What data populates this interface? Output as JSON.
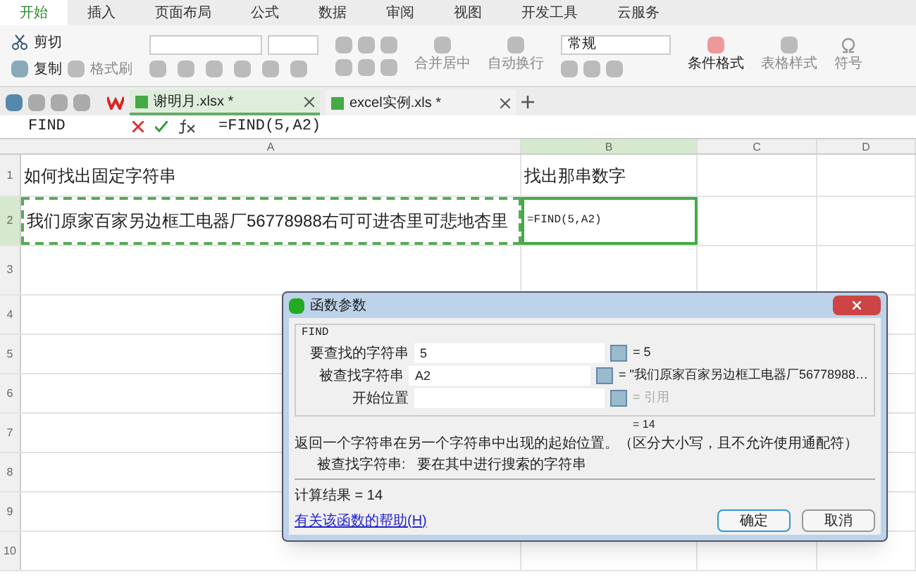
{
  "menu_tabs": [
    {
      "label": "开始",
      "selected": true
    },
    {
      "label": "插入",
      "selected": false
    },
    {
      "label": "页面布局",
      "selected": false
    },
    {
      "label": "公式",
      "selected": false
    },
    {
      "label": "数据",
      "selected": false
    },
    {
      "label": "审阅",
      "selected": false
    },
    {
      "label": "视图",
      "selected": false
    },
    {
      "label": "开发工具",
      "selected": false
    },
    {
      "label": "云服务",
      "selected": false
    }
  ],
  "ribbon": {
    "cut": "剪切",
    "copy": "复制",
    "format_painter": "格式刷",
    "merge": "合并居中",
    "wrap": "自动换行",
    "number_format": "常规",
    "conditional": "条件格式",
    "table_style": "表格样式",
    "symbol": "符号"
  },
  "doc_tabs": [
    {
      "label": "谢明月.xlsx *",
      "selected": true
    },
    {
      "label": "excel实例.xls *",
      "selected": false
    }
  ],
  "formula_bar": {
    "name_box": "FIND",
    "formula": "=FIND(5,A2)"
  },
  "columns": [
    {
      "label": "A",
      "selected": false
    },
    {
      "label": "B",
      "selected": true
    },
    {
      "label": "C",
      "selected": false
    },
    {
      "label": "D",
      "selected": false
    }
  ],
  "rows": [
    {
      "label": "1",
      "selected": false,
      "cells": [
        "如何找出固定字符串",
        "找出那串数字"
      ]
    },
    {
      "label": "2",
      "selected": true,
      "cells": [
        "我们原家百家另边框工电器厂56778988右可可进杏里可悲地杏里",
        "=FIND(5,A2)"
      ]
    },
    {
      "label": "3",
      "selected": false,
      "cells": []
    },
    {
      "label": "4",
      "selected": false,
      "cells": []
    },
    {
      "label": "5",
      "selected": false,
      "cells": []
    },
    {
      "label": "6",
      "selected": false,
      "cells": []
    },
    {
      "label": "7",
      "selected": false,
      "cells": []
    },
    {
      "label": "8",
      "selected": false,
      "cells": []
    },
    {
      "label": "9",
      "selected": false,
      "cells": []
    },
    {
      "label": "10",
      "selected": false,
      "cells": []
    }
  ],
  "dialog": {
    "title": "函数参数",
    "function": "FIND",
    "args": [
      {
        "label": "要查找的字符串",
        "value": "5",
        "result": "= 5",
        "disabled": false
      },
      {
        "label": "被查找字符串",
        "value": "A2",
        "result": "= \"我们原家百家另边框工电器厂56778988…",
        "disabled": false
      },
      {
        "label": "开始位置",
        "result": "= 引用",
        "disabled": true
      }
    ],
    "total": "= 14",
    "description": "返回一个字符串在另一个字符串中出现的起始位置。（区分大小写，且不允许使用通配符）",
    "arg_label": "被查找字符串:",
    "arg_help": "要在其中进行搜索的字符串",
    "result": "计算结果 = 14",
    "help_link": "有关该函数的帮助(H)",
    "buttons": [
      "确定",
      "取消"
    ]
  }
}
